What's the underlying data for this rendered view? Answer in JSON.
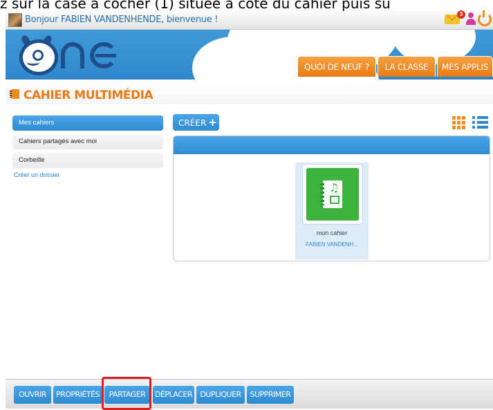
{
  "caption": "z sur la case à cocher (1) située à côté du cahier puis su",
  "topbar": {
    "greeting": "Bonjour FABIEN VANDENHENDE, bienvenue !",
    "mail_badge": "3"
  },
  "nav": {
    "items": [
      "QUOI DE NEUF ?",
      "LA CLASSE",
      "MES APPLIS"
    ]
  },
  "page": {
    "title": "CAHIER MULTIMÉDIA"
  },
  "sidebar": {
    "items": [
      "Mes cahiers",
      "Cahiers partagés avec moi",
      "Corbeille"
    ],
    "active_index": 0,
    "create_folder": "Créer un dossier"
  },
  "toolbar": {
    "create_label": "CRÉER",
    "create_plus": "+"
  },
  "notebooks": [
    {
      "title": "mon cahier",
      "owner": "FABIEN VANDENH..."
    }
  ],
  "actions": [
    "OUVRIR",
    "PROPRIÉTÉS",
    "PARTAGER",
    "DÉPLACER",
    "DUPLIQUER",
    "SUPPRIMER"
  ],
  "highlighted_action": "PARTAGER",
  "colors": {
    "accent_blue": "#2f88cc",
    "accent_orange": "#ea7b12",
    "notebook_green": "#3db23d",
    "highlight_red": "#e01b1b"
  }
}
